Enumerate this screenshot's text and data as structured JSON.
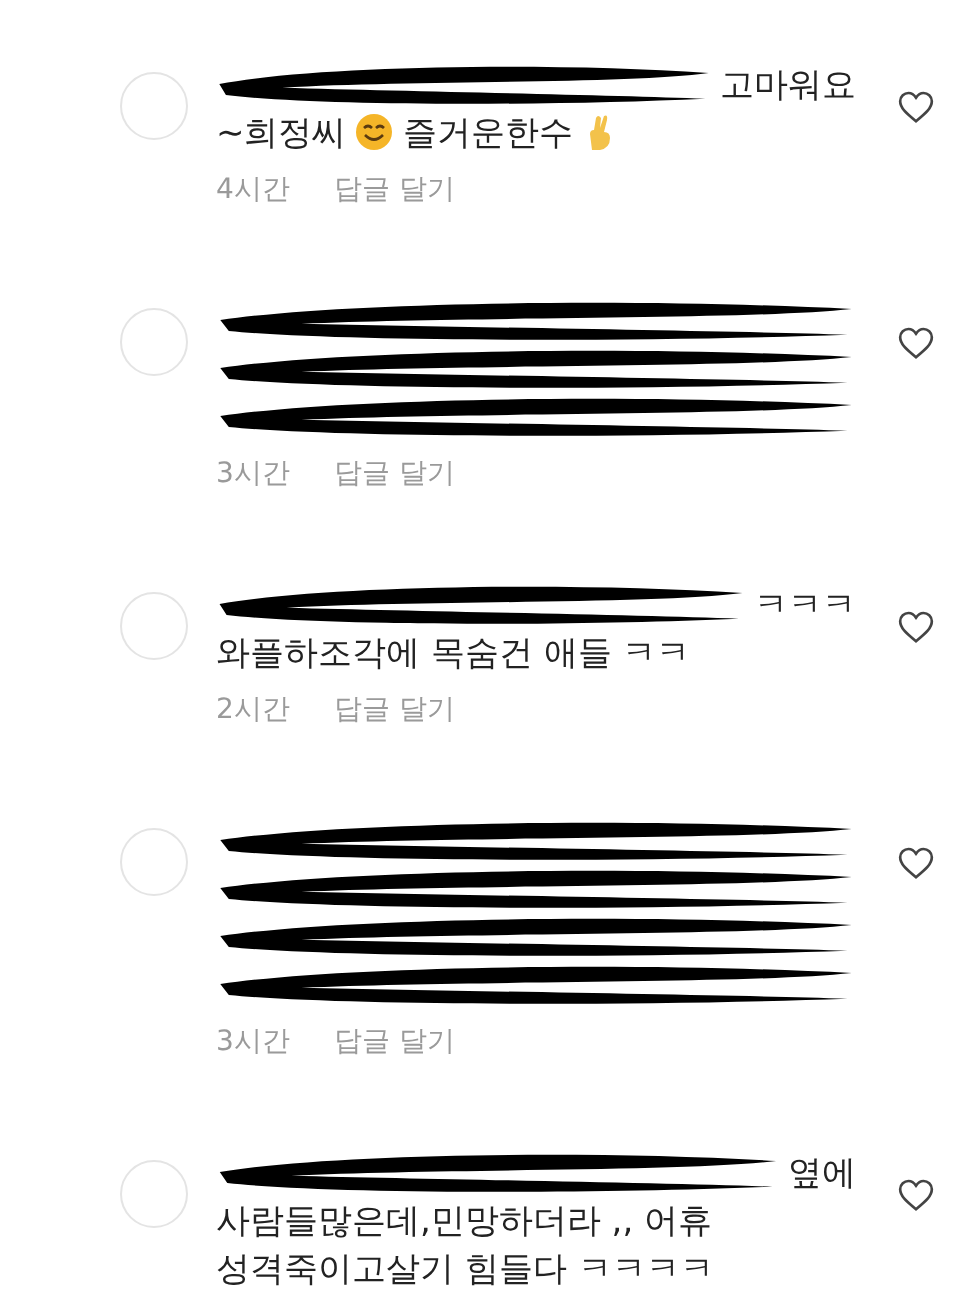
{
  "comments": [
    {
      "lines": [
        [
          {
            "kind": "scribble"
          },
          {
            "kind": "text",
            "text": "고마워요"
          }
        ],
        [
          {
            "kind": "text",
            "text": "~희정씨"
          },
          {
            "kind": "smiley"
          },
          {
            "kind": "text",
            "text": "즐거운한수"
          },
          {
            "kind": "hand"
          }
        ]
      ],
      "time": "4시간",
      "reply": "답글 달기"
    },
    {
      "lines": [
        [
          {
            "kind": "scribble"
          }
        ],
        [
          {
            "kind": "scribble"
          }
        ],
        [
          {
            "kind": "scribble"
          }
        ]
      ],
      "time": "3시간",
      "reply": "답글 달기"
    },
    {
      "lines": [
        [
          {
            "kind": "scribble"
          },
          {
            "kind": "text",
            "text": "ㅋㅋㅋ"
          }
        ],
        [
          {
            "kind": "text",
            "text": "와플하조각에 목숨건 애들 ㅋㅋ"
          }
        ]
      ],
      "time": "2시간",
      "reply": "답글 달기"
    },
    {
      "lines": [
        [
          {
            "kind": "scribble"
          }
        ],
        [
          {
            "kind": "scribble"
          }
        ],
        [
          {
            "kind": "scribble"
          }
        ],
        [
          {
            "kind": "scribble"
          }
        ]
      ],
      "time": "3시간",
      "reply": "답글 달기"
    },
    {
      "lines": [
        [
          {
            "kind": "scribble"
          },
          {
            "kind": "text",
            "text": "옆에"
          }
        ],
        [
          {
            "kind": "text",
            "text": "사람들많은데,민망하더라 ,, 어휴"
          }
        ],
        [
          {
            "kind": "text",
            "text": "성격죽이고살기 힘들다 ㅋㅋㅋㅋ"
          }
        ]
      ]
    }
  ]
}
